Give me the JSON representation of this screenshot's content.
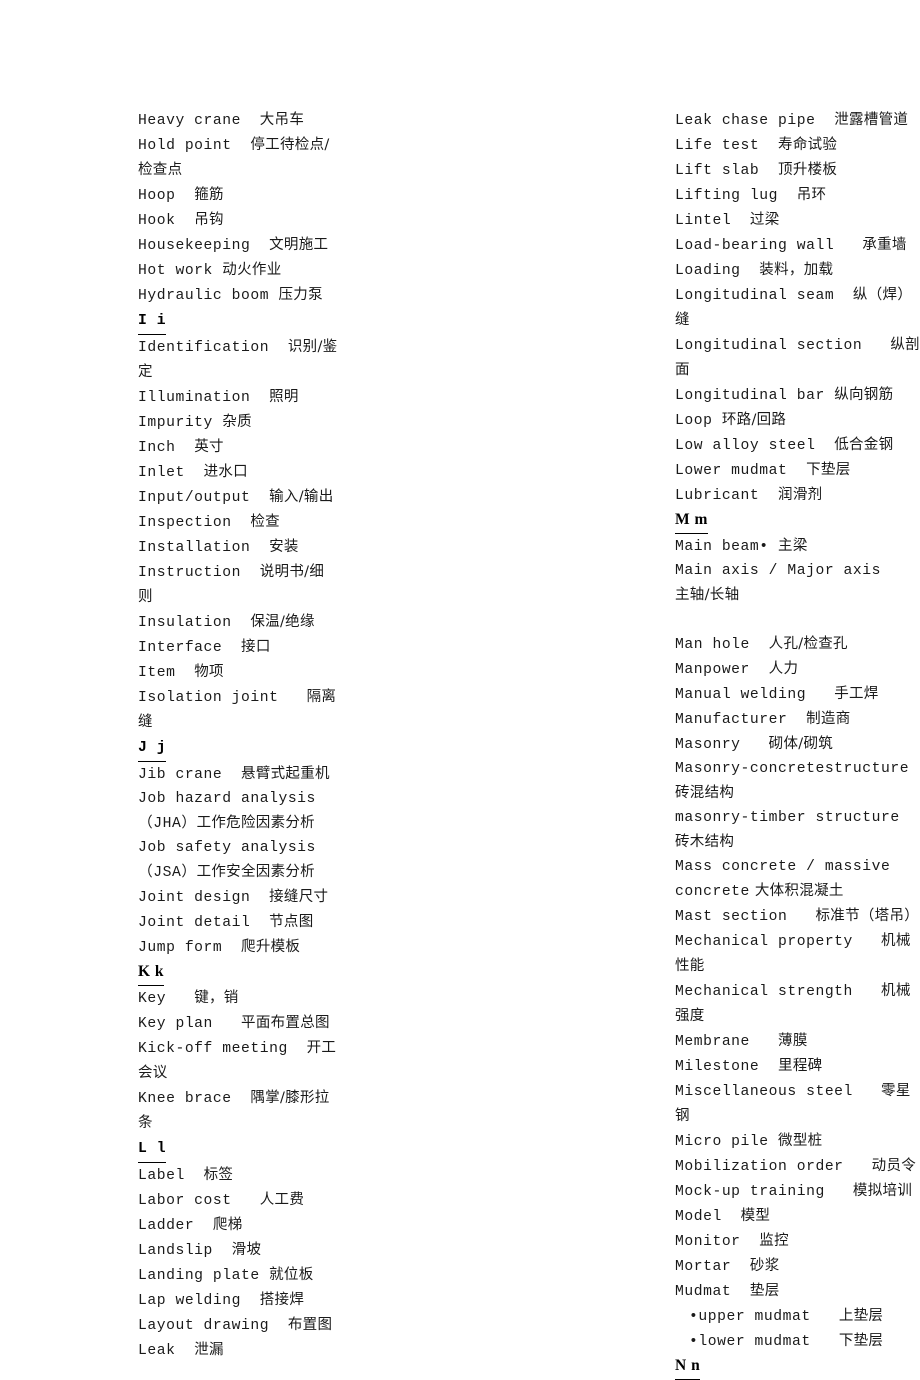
{
  "document": {
    "type": "bilingual-glossary",
    "language_pair": "English-Chinese",
    "columns": 2
  },
  "left_column": {
    "lines": [
      {
        "kind": "entry",
        "en": "Heavy crane",
        "gap": "  ",
        "cn": "大吊车"
      },
      {
        "kind": "entry",
        "en": "Hold point",
        "gap": "  ",
        "cn": "停工待检点/检查点"
      },
      {
        "kind": "entry",
        "en": "Hoop",
        "gap": "  ",
        "cn": "箍筋"
      },
      {
        "kind": "entry",
        "en": "Hook",
        "gap": "  ",
        "cn": "吊钩"
      },
      {
        "kind": "entry",
        "en": "Housekeeping",
        "gap": "  ",
        "cn": "文明施工"
      },
      {
        "kind": "entry",
        "en": "Hot work",
        "gap": " ",
        "cn": "动火作业"
      },
      {
        "kind": "entry",
        "en": "Hydraulic boom",
        "gap": " ",
        "cn": "压力泵"
      },
      {
        "kind": "section",
        "label": "I i",
        "style": "mono"
      },
      {
        "kind": "entry",
        "en": "Identification",
        "gap": "  ",
        "cn": "识别/鉴定"
      },
      {
        "kind": "entry",
        "en": "Illumination",
        "gap": "  ",
        "cn": "照明"
      },
      {
        "kind": "entry",
        "en": "Impurity",
        "gap": " ",
        "cn": "杂质"
      },
      {
        "kind": "entry",
        "en": "Inch",
        "gap": "  ",
        "cn": "英寸"
      },
      {
        "kind": "entry",
        "en": "Inlet",
        "gap": "  ",
        "cn": "进水口"
      },
      {
        "kind": "entry",
        "en": "Input/output",
        "gap": "  ",
        "cn": "输入/输出"
      },
      {
        "kind": "entry",
        "en": "Inspection",
        "gap": "  ",
        "cn": "检查"
      },
      {
        "kind": "entry",
        "en": "Installation",
        "gap": "  ",
        "cn": "安装"
      },
      {
        "kind": "entry",
        "en": "Instruction",
        "gap": "  ",
        "cn": "说明书/细则"
      },
      {
        "kind": "entry",
        "en": "Insulation",
        "gap": "  ",
        "cn": "保温/绝缘"
      },
      {
        "kind": "entry",
        "en": "Interface",
        "gap": "  ",
        "cn": "接口"
      },
      {
        "kind": "entry",
        "en": "Item",
        "gap": "  ",
        "cn": "物项"
      },
      {
        "kind": "entry",
        "en": "Isolation joint",
        "gap": "   ",
        "cn": "隔离缝"
      },
      {
        "kind": "section",
        "label": "J j",
        "style": "mono"
      },
      {
        "kind": "entry",
        "en": "Jib crane",
        "gap": "  ",
        "cn": "悬臂式起重机"
      },
      {
        "kind": "entry",
        "en": "Job hazard analysis（JHA）",
        "gap": "",
        "cn": "工作危险因素分析",
        "wraps": true
      },
      {
        "kind": "entry",
        "en": "Job safety analysis（JSA）",
        "gap": "",
        "cn": "工作安全因素分析",
        "wraps": true
      },
      {
        "kind": "entry",
        "en": "Joint design",
        "gap": "  ",
        "cn": "接缝尺寸"
      },
      {
        "kind": "entry",
        "en": "Joint detail",
        "gap": "  ",
        "cn": "节点图"
      },
      {
        "kind": "entry",
        "en": "Jump form",
        "gap": "  ",
        "cn": "爬升模板"
      },
      {
        "kind": "section",
        "label": "K k",
        "style": "serif"
      },
      {
        "kind": "entry",
        "en": "Key",
        "gap": "   ",
        "cn": "键，销"
      },
      {
        "kind": "entry",
        "en": "Key plan",
        "gap": "   ",
        "cn": "平面布置总图"
      },
      {
        "kind": "entry",
        "en": "Kick-off meeting",
        "gap": "  ",
        "cn": "开工会议"
      },
      {
        "kind": "entry",
        "en": "Knee brace",
        "gap": "  ",
        "cn": "隅掌/膝形拉条"
      },
      {
        "kind": "section",
        "label": "L l",
        "style": "mono"
      },
      {
        "kind": "entry",
        "en": "Label",
        "gap": "  ",
        "cn": "标签"
      },
      {
        "kind": "entry",
        "en": "Labor cost",
        "gap": "   ",
        "cn": "人工费"
      },
      {
        "kind": "entry",
        "en": "Ladder",
        "gap": "  ",
        "cn": "爬梯"
      },
      {
        "kind": "entry",
        "en": "Landslip",
        "gap": "  ",
        "cn": "滑坡"
      },
      {
        "kind": "entry",
        "en": "Landing plate",
        "gap": " ",
        "cn": "就位板"
      },
      {
        "kind": "entry",
        "en": "Lap welding",
        "gap": "  ",
        "cn": "搭接焊"
      },
      {
        "kind": "entry",
        "en": "Layout drawing",
        "gap": "  ",
        "cn": "布置图"
      },
      {
        "kind": "entry",
        "en": "Leak",
        "gap": "  ",
        "cn": "泄漏"
      }
    ]
  },
  "right_column": {
    "lines": [
      {
        "kind": "entry",
        "en": "Leak chase pipe",
        "gap": "  ",
        "cn": "泄露槽管道"
      },
      {
        "kind": "entry",
        "en": "Life test",
        "gap": "  ",
        "cn": "寿命试验"
      },
      {
        "kind": "entry",
        "en": "Lift slab",
        "gap": "  ",
        "cn": "顶升楼板"
      },
      {
        "kind": "entry",
        "en": "Lifting lug",
        "gap": "  ",
        "cn": "吊环"
      },
      {
        "kind": "entry",
        "en": "Lintel",
        "gap": "  ",
        "cn": "过梁"
      },
      {
        "kind": "entry",
        "en": "Load-bearing wall",
        "gap": "   ",
        "cn": "承重墙"
      },
      {
        "kind": "entry",
        "en": "Loading",
        "gap": "  ",
        "cn": "装料，加载"
      },
      {
        "kind": "entry",
        "en": "Longitudinal seam",
        "gap": "  ",
        "cn": "纵（焊）缝"
      },
      {
        "kind": "entry",
        "en": "Longitudinal section",
        "gap": "   ",
        "cn": "纵剖面"
      },
      {
        "kind": "entry",
        "en": "Longitudinal bar",
        "gap": " ",
        "cn": "纵向钢筋"
      },
      {
        "kind": "entry",
        "en": "Loop",
        "gap": " ",
        "cn": "环路/回路"
      },
      {
        "kind": "entry",
        "en": "Low alloy steel",
        "gap": "  ",
        "cn": "低合金钢"
      },
      {
        "kind": "entry",
        "en": "Lower mudmat",
        "gap": "  ",
        "cn": "下垫层"
      },
      {
        "kind": "entry",
        "en": "Lubricant",
        "gap": "  ",
        "cn": "润滑剂"
      },
      {
        "kind": "section",
        "label": "M m",
        "style": "serif"
      },
      {
        "kind": "entry",
        "en": "Main beam•",
        "gap": " ",
        "cn": "主梁"
      },
      {
        "kind": "entry",
        "en": "Main axis / Major axis",
        "gap": "   ",
        "cn": "主轴/长轴"
      },
      {
        "kind": "blank"
      },
      {
        "kind": "entry",
        "en": "Man hole",
        "gap": "  ",
        "cn": "人孔/检查孔"
      },
      {
        "kind": "entry",
        "en": "Manpower",
        "gap": "  ",
        "cn": "人力"
      },
      {
        "kind": "entry",
        "en": "Manual welding",
        "gap": "   ",
        "cn": "手工焊"
      },
      {
        "kind": "entry",
        "en": "Manufacturer",
        "gap": "  ",
        "cn": "制造商"
      },
      {
        "kind": "entry",
        "en": "Masonry",
        "gap": "   ",
        "cn": "砌体/砌筑"
      },
      {
        "kind": "entry",
        "en": "Masonry-concretestructure",
        "gap": " ",
        "cn": "砖混结构",
        "wraps": true
      },
      {
        "kind": "entry",
        "en": "masonry-timber structure",
        "gap": "  ",
        "cn": "砖木结构"
      },
      {
        "kind": "entry",
        "en": "Mass concrete / massive concrete",
        "gap": "",
        "cn": " 大体积混凝土",
        "wraps": true
      },
      {
        "kind": "entry",
        "en": "Mast section",
        "gap": "   ",
        "cn": "标准节（塔吊）"
      },
      {
        "kind": "entry",
        "en": "Mechanical property",
        "gap": "   ",
        "cn": "机械性能"
      },
      {
        "kind": "entry",
        "en": "Mechanical strength",
        "gap": "   ",
        "cn": "机械强度"
      },
      {
        "kind": "entry",
        "en": "Membrane",
        "gap": "   ",
        "cn": "薄膜"
      },
      {
        "kind": "entry",
        "en": "Milestone",
        "gap": "  ",
        "cn": "里程碑"
      },
      {
        "kind": "entry",
        "en": "Miscellaneous steel",
        "gap": "   ",
        "cn": "零星钢"
      },
      {
        "kind": "entry",
        "en": "Micro pile",
        "gap": " ",
        "cn": "微型桩"
      },
      {
        "kind": "entry",
        "en": "Mobilization order",
        "gap": "   ",
        "cn": "动员令"
      },
      {
        "kind": "entry",
        "en": "Mock-up training",
        "gap": "   ",
        "cn": "模拟培训"
      },
      {
        "kind": "entry",
        "en": "Model",
        "gap": "  ",
        "cn": "模型"
      },
      {
        "kind": "entry",
        "en": "Monitor",
        "gap": "  ",
        "cn": "监控"
      },
      {
        "kind": "entry",
        "en": "Mortar",
        "gap": "  ",
        "cn": "砂浆"
      },
      {
        "kind": "entry",
        "en": "Mudmat",
        "gap": "  ",
        "cn": "垫层"
      },
      {
        "kind": "entry",
        "en": "•upper mudmat",
        "gap": "   ",
        "cn": "上垫层",
        "indent": true
      },
      {
        "kind": "entry",
        "en": "•lower mudmat",
        "gap": "   ",
        "cn": "下垫层",
        "indent": true
      },
      {
        "kind": "section",
        "label": "N n",
        "style": "serif"
      }
    ]
  }
}
